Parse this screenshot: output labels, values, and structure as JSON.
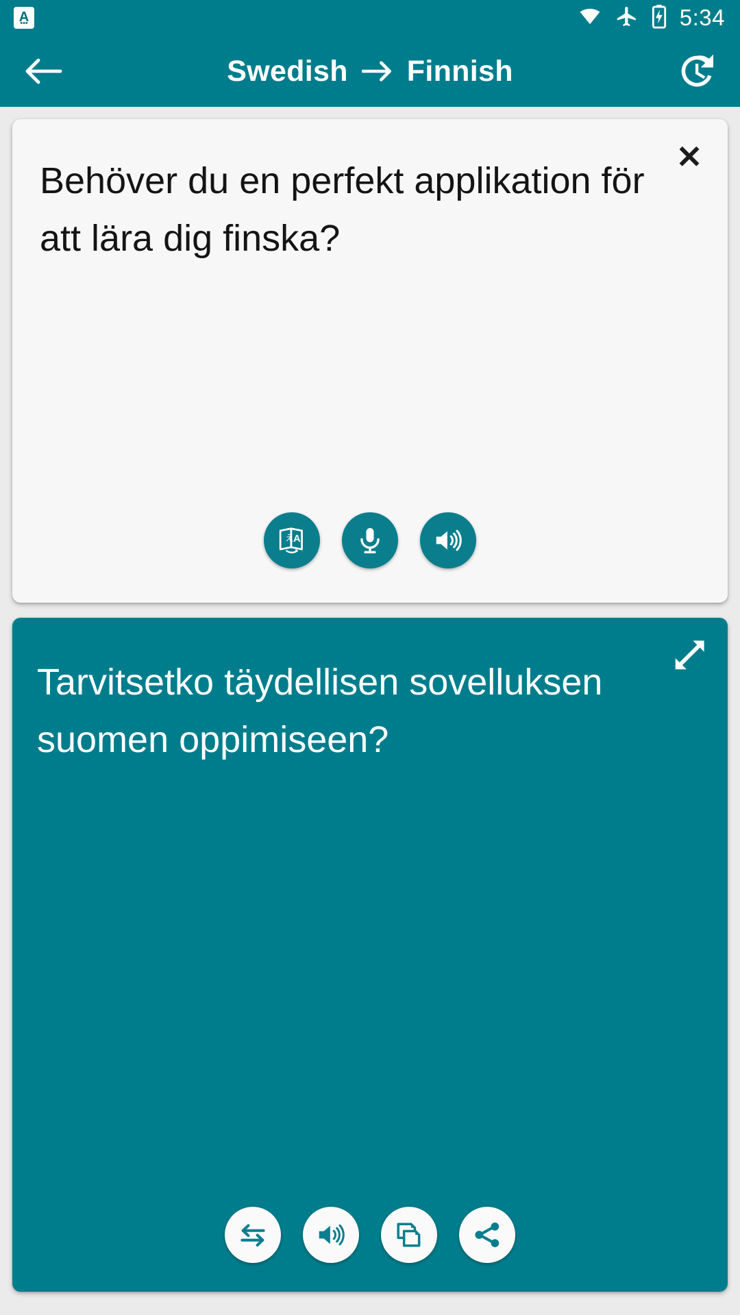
{
  "colors": {
    "brand_teal": "#007D8C",
    "fab_teal": "#0A7E8D",
    "page_background": "#ebebeb",
    "source_card_background": "#f7f7f7",
    "source_text": "#141414",
    "target_text": "#ffffff"
  },
  "status_bar": {
    "notification": {
      "icon": "app-notification-icon",
      "letter": "A",
      "dots": "•••"
    },
    "icons": [
      "wifi-icon",
      "airplane-mode-icon",
      "battery-charging-icon"
    ],
    "time": "5:34"
  },
  "header": {
    "back": {
      "icon": "back-arrow-icon",
      "label": "Back"
    },
    "source_language": "Swedish",
    "arrow": "→",
    "target_language": "Finnish",
    "history": {
      "icon": "history-icon",
      "label": "History"
    }
  },
  "source_card": {
    "text": "Behöver du en perfekt applikation för att lära dig finska?",
    "close": {
      "icon": "close-icon",
      "glyph": "✕",
      "label": "Clear"
    },
    "actions": [
      {
        "name": "translate-button",
        "icon": "translate-icon",
        "label": "Translate"
      },
      {
        "name": "microphone-button",
        "icon": "microphone-icon",
        "label": "Speak"
      },
      {
        "name": "listen-source-button",
        "icon": "speaker-icon",
        "label": "Listen"
      }
    ]
  },
  "target_card": {
    "text": "Tarvitsetko täydellisen sovelluksen suomen oppimiseen?",
    "expand": {
      "icon": "expand-icon",
      "label": "Fullscreen"
    },
    "actions": [
      {
        "name": "swap-languages-button",
        "icon": "swap-arrows-icon",
        "label": "Swap"
      },
      {
        "name": "listen-target-button",
        "icon": "speaker-icon",
        "label": "Listen"
      },
      {
        "name": "copy-button",
        "icon": "copy-icon",
        "label": "Copy"
      },
      {
        "name": "share-button",
        "icon": "share-icon",
        "label": "Share"
      }
    ]
  }
}
